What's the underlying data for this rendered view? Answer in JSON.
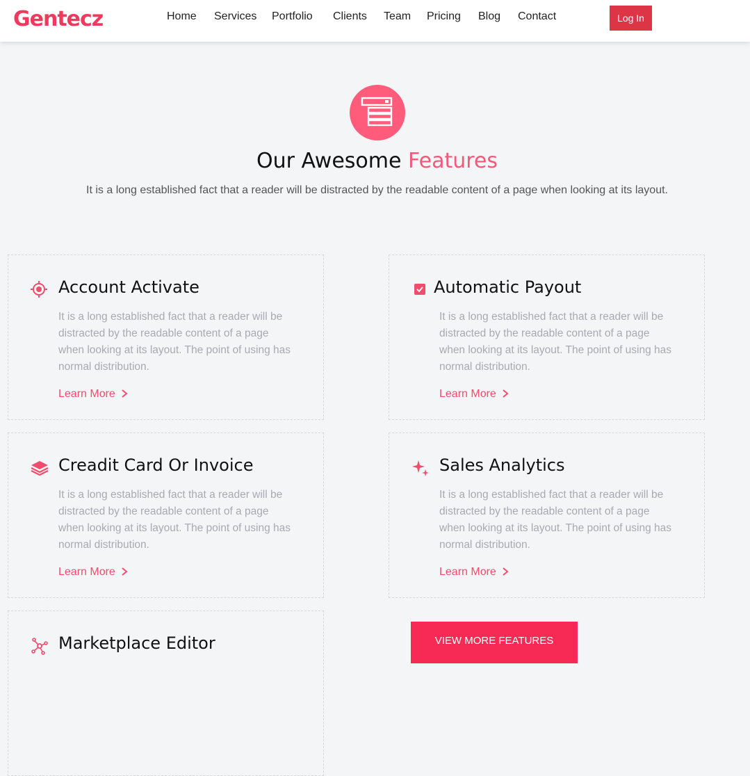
{
  "brand": {
    "logo_text": "Gentecz",
    "accent_color": "#ef3a5d"
  },
  "nav": {
    "items": [
      "Home",
      "Services",
      "Portfolio",
      "Clients",
      "Team",
      "Pricing",
      "Blog",
      "Contact"
    ],
    "login_label": "Log In"
  },
  "hero": {
    "icon": "server-rack-icon",
    "title_main": "Our Awesome ",
    "title_accent": "Features",
    "subtitle": "It is a long established fact that a reader will be distracted by the readable content of a page when looking at its layout."
  },
  "features": [
    {
      "icon": "target-icon",
      "title": "Account Activate",
      "text": "It is a long established fact that a reader will be distracted by the readable content of a page when looking at its layout. The point of using has normal distribution.",
      "link": "Learn More"
    },
    {
      "icon": "checkbox-icon",
      "title": "Automatic Payout",
      "text": "It is a long established fact that a reader will be distracted by the readable content of a page when looking at its layout. The point of using has normal distribution.",
      "link": "Learn More"
    },
    {
      "icon": "layers-icon",
      "title": "Creadit Card Or Invoice",
      "text": "It is a long established fact that a reader will be distracted by the readable content of a page when looking at its layout. The point of using has normal distribution.",
      "link": "Learn More"
    },
    {
      "icon": "sparkle-icon",
      "title": "Sales Analytics",
      "text": "It is a long established fact that a reader will be distracted by the readable content of a page when looking at its layout. The point of using has normal distribution.",
      "link": "Learn More"
    },
    {
      "icon": "network-icon",
      "title": "Marketplace Editor"
    }
  ],
  "view_more_label": "VIEW MORE FEATURES"
}
